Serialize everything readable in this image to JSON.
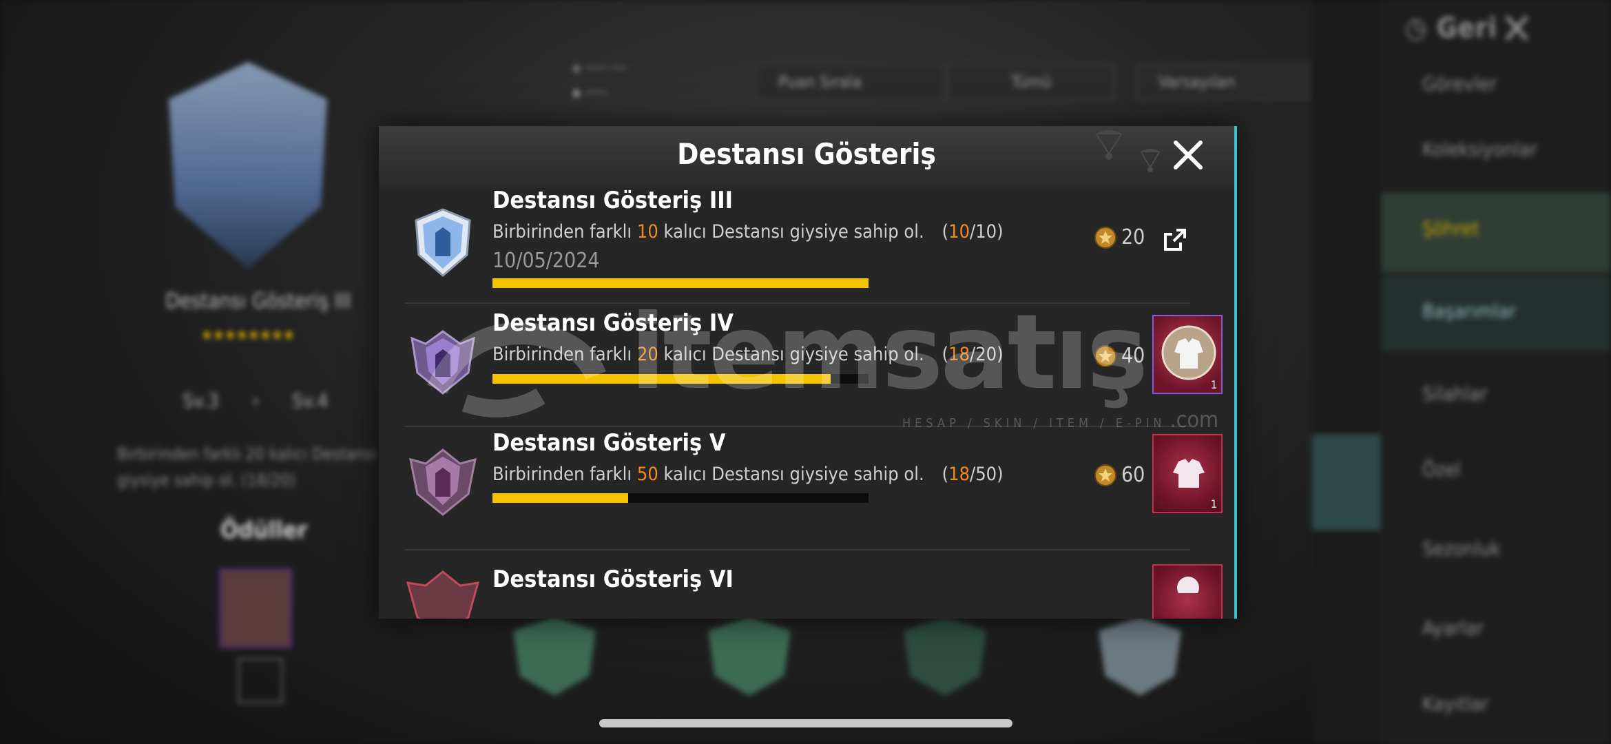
{
  "background": {
    "top_right": {
      "back_label": "Geri"
    },
    "left_panel": {
      "title": "Destansı Gösteriş III",
      "level_range": [
        "Sv.3",
        "Sv.4"
      ],
      "description": "Birbirinden farklı 20 kalıcı Destansı giysiye sahip ol. (18/20)",
      "rewards_label": "Ödüller"
    },
    "dropdowns": [
      "Puan Sırala",
      "Tümü",
      "Varsayılan"
    ],
    "right_menu": [
      "Görevler",
      "Koleksiyonlar",
      "Şöhret",
      "Başarımlar",
      "Silahlar",
      "Özel",
      "Sezonluk",
      "Ayarlar",
      "Kayıtlar"
    ]
  },
  "modal": {
    "title": "Destansı Gösteriş",
    "rows": [
      {
        "title": "Destansı Gösteriş III",
        "desc_pre": "Birbirinden farklı ",
        "desc_num": "10",
        "desc_post": " kalıcı Destansı giysiye sahip ol.",
        "prog_open": "(",
        "prog_cur": "10",
        "prog_rest": "/10)",
        "date": "10/05/2024",
        "points": "20",
        "progress": 1.0,
        "badge_color": "#8fb6e8",
        "reward": "share"
      },
      {
        "title": "Destansı Gösteriş IV",
        "desc_pre": "Birbirinden farklı ",
        "desc_num": "20",
        "desc_post": " kalıcı Destansı giysiye sahip ol.",
        "prog_open": "(",
        "prog_cur": "18",
        "prog_rest": "/20)",
        "points": "40",
        "progress": 0.9,
        "badge_color": "#9a7fd0",
        "reward": "item",
        "reward_qty": "1"
      },
      {
        "title": "Destansı Gösteriş V",
        "desc_pre": "Birbirinden farklı ",
        "desc_num": "50",
        "desc_post": " kalıcı Destansı giysiye sahip ol.",
        "prog_open": "(",
        "prog_cur": "18",
        "prog_rest": "/50)",
        "points": "60",
        "progress": 0.36,
        "badge_color": "#a87aa8",
        "reward": "item",
        "reward_qty": "1"
      },
      {
        "title": "Destansı Gösteriş VI"
      }
    ]
  },
  "watermark": {
    "text": "itemsatış",
    "tagline": "HESAP / SKIN / ITEM / E-PIN",
    "domain": ".com"
  },
  "colors": {
    "accent": "#f08a1c",
    "progress": "#f5c200",
    "modal_edge": "#3fc0cf"
  }
}
